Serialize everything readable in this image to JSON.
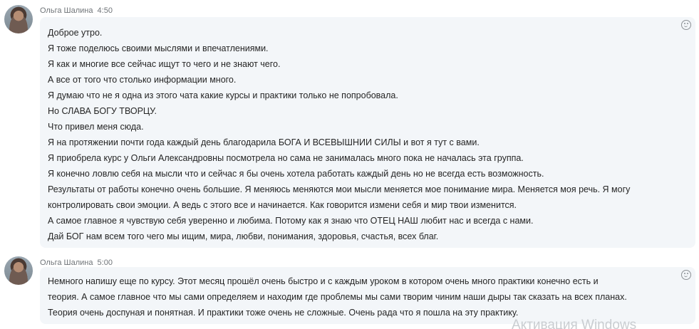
{
  "messages": [
    {
      "sender": "Ольга Шалина",
      "time": "4:50",
      "lines": [
        "Доброе утро.",
        "Я тоже поделюсь своими мыслями и впечатлениями.",
        "Я как и многие все сейчас ищут то чего и не знают чего.",
        "А все от того что столько информации много.",
        "Я думаю что не я одна из этого чата какие курсы и практики только не попробовала.",
        "Но СЛАВА БОГУ ТВОРЦУ.",
        "Что привел меня сюда.",
        "Я на протяжении  почти года каждый день благодарила БОГА И ВСЕВЫШНИИ СИЛЫ и вот я тут с вами.",
        "Я приобрела курс у Ольги Александровны посмотрела но сама не занималась много пока не началась эта группа.",
        "Я конечно ловлю себя на мысли что и сейчас я бы очень хотела работать каждый день но не всегда есть возможность.",
        "Результаты от работы конечно очень большие. Я меняюсь меняются мои мысли меняется мое понимание мира. Меняется моя речь. Я могу",
        "контролировать свои эмоции. А ведь с этого все и начинается. Как говорится измени себя и мир твои изменится.",
        "А самое главное я чувствую себя уверенно и любима. Потому как я знаю что ОТЕЦ НАШ любит нас и всегда с нами.",
        "Дай БОГ нам всем того чего мы ищим, мира, любви, понимания, здоровья, счастья, всех благ."
      ]
    },
    {
      "sender": "Ольга Шалина",
      "time": "5:00",
      "lines": [
        "Немного напишу еще по курсу. Этот месяц прошёл очень быстро и с каждым уроком в котором очень много практики конечно есть и",
        "теория. А самое главное что мы сами определяем и находим где проблемы мы сами творим чиним наши дыры так сказать на всех планах.",
        "Теория очень доспуная и понятная. И практики тоже очень не сложные. Очень рада что я пошла на эту практику."
      ]
    }
  ],
  "watermark": "Активация Windows",
  "icons": {
    "avatar": "avatar",
    "reaction": "smiley-icon"
  }
}
